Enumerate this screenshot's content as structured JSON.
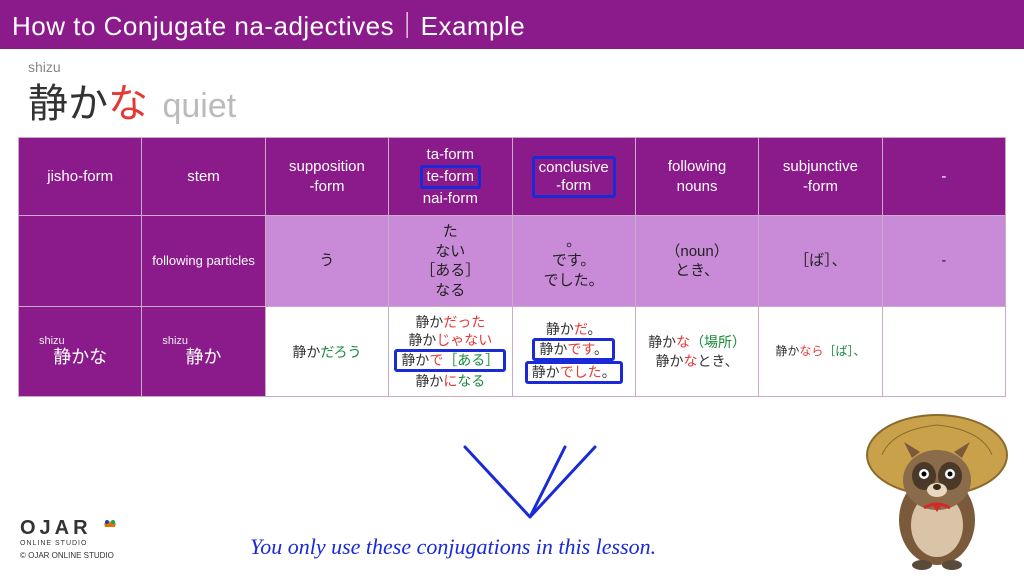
{
  "banner": "How to Conjugate na-adjectives｜Example",
  "headword": {
    "ruby": "shizu",
    "stem": "静か",
    "na": "な",
    "en": "quiet"
  },
  "headers": {
    "c1": "jisho-form",
    "c2": "stem",
    "c3_a": "supposition",
    "c3_b": "-form",
    "c4_a": "ta-form",
    "c4_b": "te-form",
    "c4_c": "nai-form",
    "c5_a": "conclusive",
    "c5_b": "-form",
    "c6_a": "following",
    "c6_b": "nouns",
    "c7_a": "subjunctive",
    "c7_b": "-form",
    "c8": "-"
  },
  "suffix": {
    "c2": "following particles",
    "c3": "う",
    "c4_a": "た",
    "c4_b": "ない",
    "c4_c": "［ある］",
    "c4_d": "なる",
    "c5_a": "。",
    "c5_b": "です。",
    "c5_c": "でした。",
    "c6_a": "（noun）",
    "c6_b": "とき、",
    "c7": "［ば］、",
    "c8": "-"
  },
  "example": {
    "ruby1": "shizu",
    "c1": "静かな",
    "ruby2": "shizu",
    "c2": "静か",
    "c3_stem": "静か",
    "c3_suf": "だろう",
    "c4_1_stem": "静か",
    "c4_1_suf": "だった",
    "c4_2_stem": "静か",
    "c4_2_suf": "じゃない",
    "c4_3_stem": "静か",
    "c4_3_mid": "で",
    "c4_3_suf": "［ある］",
    "c4_4_stem": "静か",
    "c4_4_mid": "に",
    "c4_4_suf": "なる",
    "c5_1_stem": "静か",
    "c5_1_suf": "だ",
    "c5_1_end": "。",
    "c5_2_stem": "静か",
    "c5_2_suf": "です",
    "c5_2_end": "。",
    "c5_3_stem": "静か",
    "c5_3_suf": "でした",
    "c5_3_end": "。",
    "c6_1_stem": "静か",
    "c6_1_na": "な",
    "c6_1_noun": "（場所）",
    "c6_2_stem": "静か",
    "c6_2_na": "な",
    "c6_2_suf": "とき、",
    "c7_stem": "静か",
    "c7_nara": "なら",
    "c7_ba": "［ば］、"
  },
  "annotation": "You only use these conjugations in this lesson.",
  "logo": {
    "brand": "OJAR",
    "sub": "ONLINE STUDIO",
    "copyright": "© OJAR ONLINE STUDIO"
  }
}
